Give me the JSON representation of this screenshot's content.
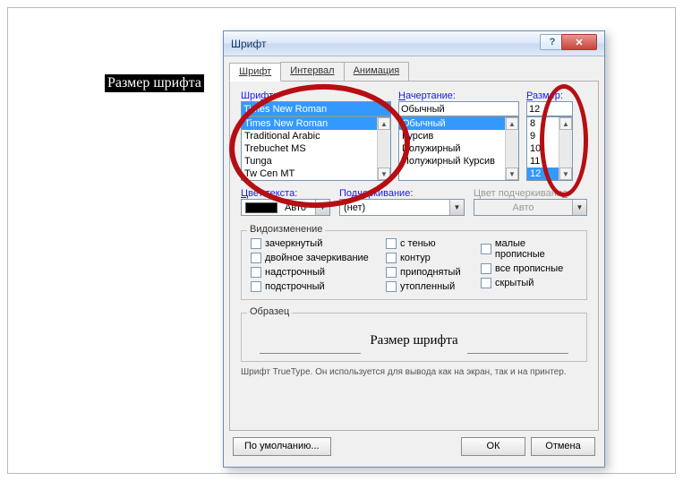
{
  "document": {
    "highlight_text": "Размер шрифта"
  },
  "dialog": {
    "title": "Шрифт",
    "tabs": {
      "t1": "Шрифт",
      "t2": "Интервал",
      "t3": "Анимация"
    },
    "font": {
      "label": "Шрифт:",
      "value": "Times New Roman",
      "list": [
        "Times New Roman",
        "Traditional Arabic",
        "Trebuchet MS",
        "Tunga",
        "Tw Cen MT"
      ]
    },
    "style": {
      "label": "Начертание:",
      "value": "Обычный",
      "list": [
        "Обычный",
        "Курсив",
        "Полужирный",
        "Полужирный Курсив"
      ]
    },
    "size": {
      "label": "Размер:",
      "value": "12",
      "list": [
        "8",
        "9",
        "10",
        "11",
        "12"
      ]
    },
    "color": {
      "label": "Цвет текста:",
      "value": "Авто"
    },
    "underline": {
      "label": "Подчеркивание:",
      "value": "(нет)"
    },
    "ucolor": {
      "label": "Цвет подчеркивания:",
      "value": "Авто"
    },
    "effects": {
      "legend": "Видоизменение",
      "c1": "зачеркнутый",
      "c2": "двойное зачеркивание",
      "c3": "надстрочный",
      "c4": "подстрочный",
      "c5": "с тенью",
      "c6": "контур",
      "c7": "приподнятый",
      "c8": "утопленный",
      "c9": "малые прописные",
      "c10": "все прописные",
      "c11": "скрытый"
    },
    "preview": {
      "legend": "Образец",
      "text": "Размер шрифта"
    },
    "hint": "Шрифт TrueType. Он используется для вывода как на экран, так и на принтер.",
    "buttons": {
      "default": "По умолчанию...",
      "ok": "ОК",
      "cancel": "Отмена"
    }
  }
}
